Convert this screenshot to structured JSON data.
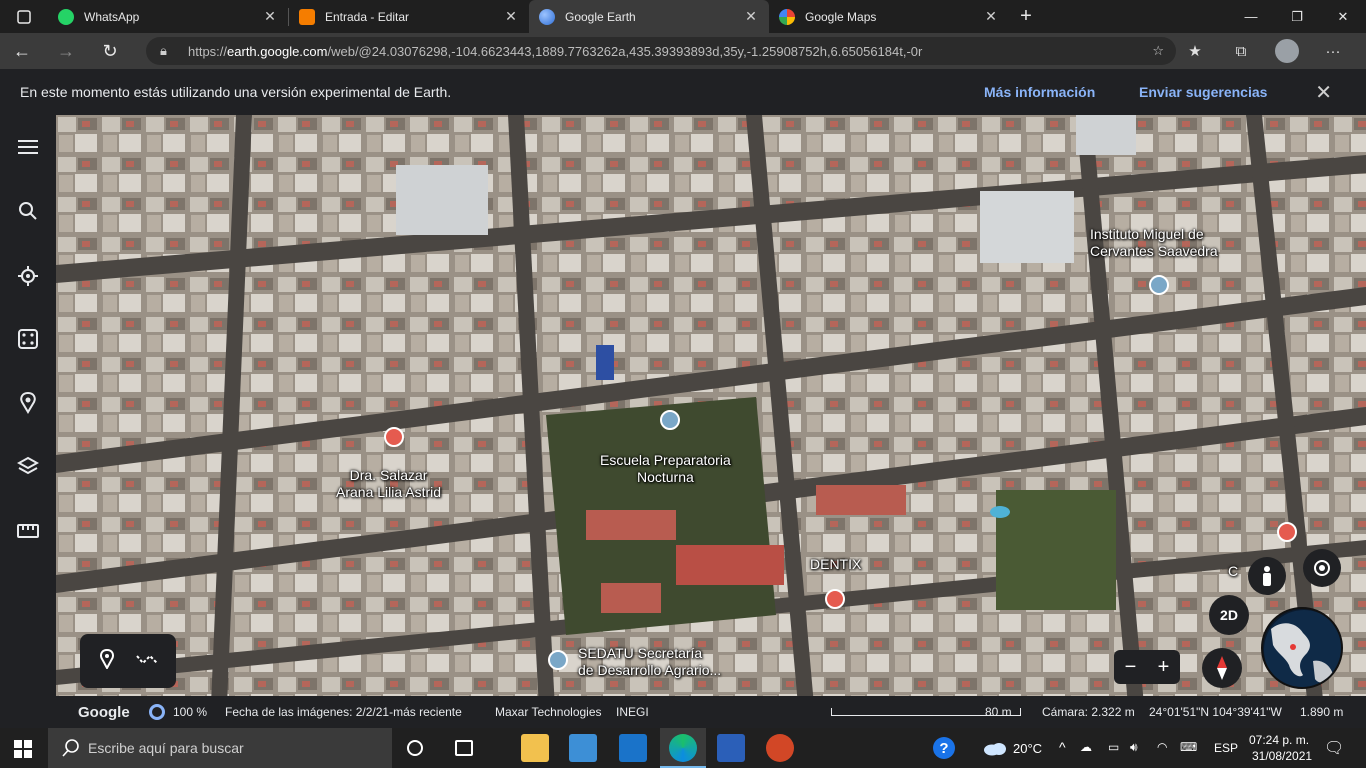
{
  "browser": {
    "tabs": [
      {
        "title": "WhatsApp",
        "icon": "whatsapp-icon",
        "color": "#25d366"
      },
      {
        "title": "Entrada - Editar",
        "icon": "blogger-icon",
        "color": "#f57d00"
      },
      {
        "title": "Google Earth",
        "icon": "earth-icon",
        "color": "#4f8df5",
        "active": true
      },
      {
        "title": "Google Maps",
        "icon": "maps-icon",
        "color": "#34a853"
      }
    ],
    "url_scheme": "https://",
    "url_host": "earth.google.com",
    "url_path": "/web/@24.03076298,-104.6623443,1889.7763262a,435.39393893d,35y,-1.25908752h,6.65056184t,-0r"
  },
  "banner": {
    "message": "En este momento estás utilizando una versión experimental de Earth.",
    "more_info": "Más información",
    "feedback": "Enviar sugerencias"
  },
  "map": {
    "labels": {
      "instituto": "Instituto Miguel de\nCervantes Saavedra",
      "salazar": "Dra. Salazar\nArana Lilia Astrid",
      "escuela": "Escuela Preparatoria\nNocturna",
      "dentix": "DENTIX",
      "sedatu": "SEDATU Secretaría\nde Desarrollo Agrario...",
      "partial": "C     LI"
    },
    "view_mode": "2D"
  },
  "status": {
    "logo": "Google",
    "load": "100 %",
    "imagery_date": "Fecha de las imágenes: 2/2/21-más reciente",
    "attribution": "Maxar Technologies",
    "attribution2": "INEGI",
    "scale": "80 m",
    "camera": "Cámara: 2.322 m",
    "coords": "24°01'51\"N 104°39'41\"W",
    "elevation": "1.890 m"
  },
  "taskbar": {
    "search_placeholder": "Escribe aquí para buscar",
    "temperature": "20°C",
    "language": "ESP",
    "time": "07:24 p. m.",
    "date": "31/08/2021"
  }
}
